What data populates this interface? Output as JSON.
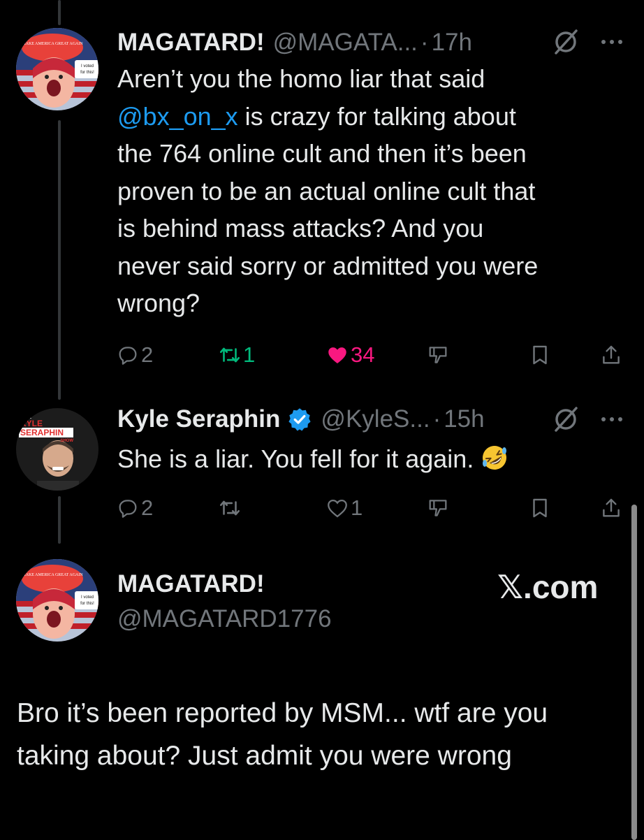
{
  "tweet1": {
    "display_name": "MAGATARD!",
    "handle": "@MAGATA...",
    "dot": "·",
    "time": "17h",
    "avatar_text_top": "MAKE AMERICA GREAT AGAIN",
    "avatar_sign": "I voted for this!",
    "text_lines": [
      "Aren’t you the homo liar that said",
      " is crazy for talking about",
      "the 764 online cult and then it’s been",
      "proven to be an actual online cult that",
      "is behind mass attacks? And you",
      "never said sorry or admitted you were",
      "wrong?"
    ],
    "mention": "@bx_on_x",
    "replies": "2",
    "retweets": "1",
    "likes": "34",
    "retweet_color": "#00ba7c",
    "like_color": "#f91880"
  },
  "tweet2": {
    "display_name": "Kyle Seraphin",
    "handle": "@KyleS...",
    "dot": "·",
    "time": "15h",
    "avatar_logo_the": "THE",
    "avatar_logo_name1": "KYLE",
    "avatar_logo_name2": "SERAPHIN",
    "avatar_logo_show": "SHOW",
    "text": "She is a liar. You fell for it again. ",
    "emoji": "rolling-on-floor-laughing",
    "replies": "2",
    "likes": "1",
    "verified_color": "#1d9bf0"
  },
  "card": {
    "display_name": "MAGATARD!",
    "handle": "@MAGATARD1776",
    "brand": "𝕏.com",
    "text": "Bro it’s been reported by MSM... wtf are you taking about? Just admit you were wrong"
  }
}
